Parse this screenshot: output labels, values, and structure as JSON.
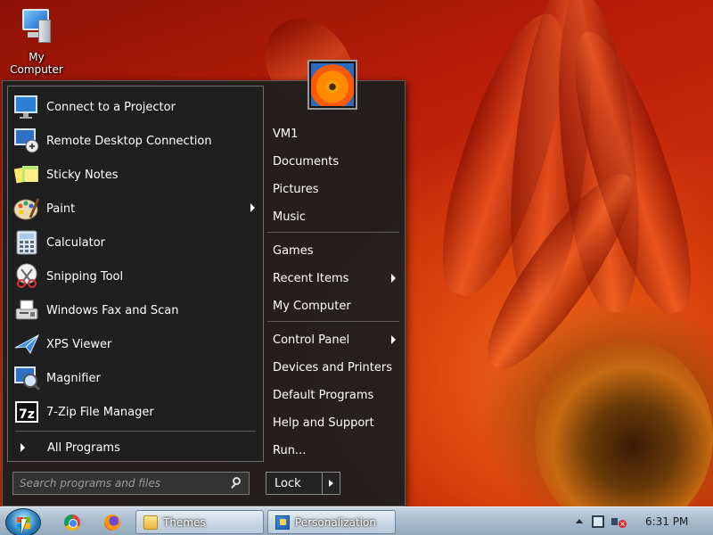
{
  "desktop": {
    "icons": [
      {
        "label": "My Computer",
        "icon": "computer-icon"
      }
    ]
  },
  "start_menu": {
    "programs": [
      {
        "label": "Connect to a Projector",
        "icon": "projector-icon",
        "has_submenu": false
      },
      {
        "label": "Remote Desktop Connection",
        "icon": "remote-desktop-icon",
        "has_submenu": false
      },
      {
        "label": "Sticky Notes",
        "icon": "sticky-notes-icon",
        "has_submenu": false
      },
      {
        "label": "Paint",
        "icon": "paint-icon",
        "has_submenu": true
      },
      {
        "label": "Calculator",
        "icon": "calculator-icon",
        "has_submenu": false
      },
      {
        "label": "Snipping Tool",
        "icon": "snipping-tool-icon",
        "has_submenu": false
      },
      {
        "label": "Windows Fax and Scan",
        "icon": "fax-icon",
        "has_submenu": false
      },
      {
        "label": "XPS Viewer",
        "icon": "xps-viewer-icon",
        "has_submenu": false
      },
      {
        "label": "Magnifier",
        "icon": "magnifier-icon",
        "has_submenu": false
      },
      {
        "label": "7-Zip File Manager",
        "icon": "7zip-icon",
        "has_submenu": false
      }
    ],
    "all_programs_label": "All Programs",
    "search_placeholder": "Search programs and files",
    "right_links": [
      {
        "label": "VM1",
        "has_submenu": false
      },
      {
        "label": "Documents",
        "has_submenu": false
      },
      {
        "label": "Pictures",
        "has_submenu": false
      },
      {
        "label": "Music",
        "has_submenu": false
      },
      {
        "label": "Games",
        "has_submenu": false
      },
      {
        "label": "Recent Items",
        "has_submenu": true
      },
      {
        "label": "My Computer",
        "has_submenu": false
      },
      {
        "label": "Control Panel",
        "has_submenu": true
      },
      {
        "label": "Devices and Printers",
        "has_submenu": false
      },
      {
        "label": "Default Programs",
        "has_submenu": false
      },
      {
        "label": "Help and Support",
        "has_submenu": false
      },
      {
        "label": "Run...",
        "has_submenu": false
      }
    ],
    "power_button_label": "Lock"
  },
  "taskbar": {
    "pinned": [
      {
        "name": "chrome",
        "icon": "chrome-icon"
      },
      {
        "name": "firefox",
        "icon": "firefox-icon"
      }
    ],
    "tasks": [
      {
        "label": "Themes",
        "icon": "folder-icon"
      },
      {
        "label": "Personalization",
        "icon": "personalization-icon"
      }
    ],
    "clock": "6:31 PM"
  },
  "colors": {
    "menu_background": "#1e1e1e",
    "taskbar_top": "#c9d7e4",
    "wallpaper_accent": "#d8400c"
  }
}
